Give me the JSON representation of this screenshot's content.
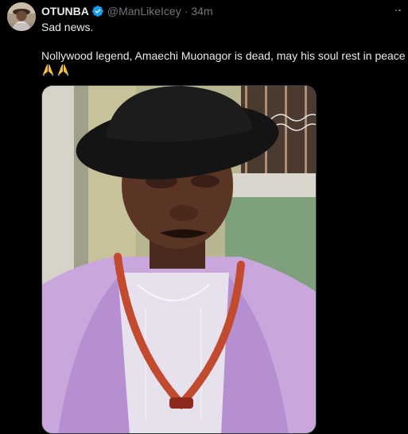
{
  "tweet": {
    "display_name": "OTUNBA",
    "handle": "@ManLikeIcey",
    "separator": "·",
    "time": "34m",
    "text_line1": "Sad news.",
    "text_line2": "Nollywood legend, Amaechi Muonagor is dead, may his soul rest in peace",
    "emojis": [
      "folded-hands-emoji",
      "folded-hands-emoji"
    ]
  },
  "icons": {
    "verified": "verified-badge-icon",
    "more": "more-options-icon"
  },
  "colors": {
    "background": "#000000",
    "primary_text": "#e7e9ea",
    "secondary_text": "#71767b",
    "verified_blue": "#1d9bf0"
  }
}
